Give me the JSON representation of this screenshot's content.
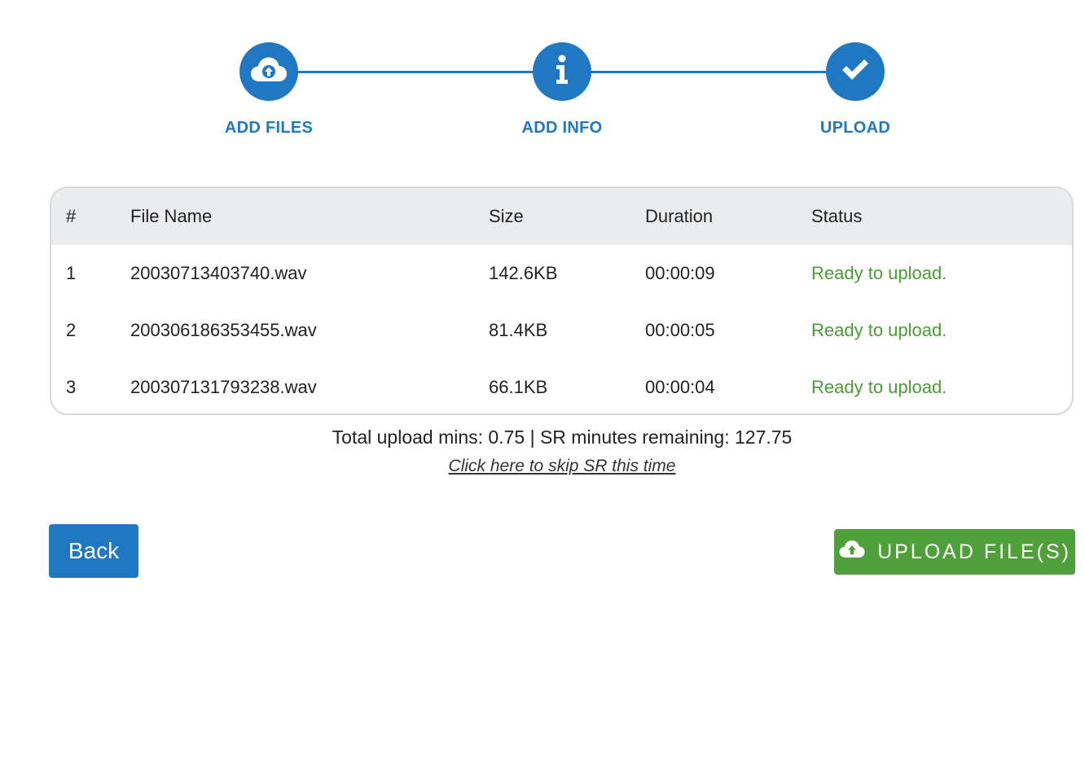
{
  "stepper": {
    "steps": [
      {
        "label": "ADD FILES",
        "icon": "cloud-upload-icon"
      },
      {
        "label": "ADD INFO",
        "icon": "info-icon"
      },
      {
        "label": "UPLOAD",
        "icon": "checkmark-icon"
      }
    ],
    "color": "#1f78c1"
  },
  "table": {
    "headers": {
      "num": "#",
      "name": "File Name",
      "size": "Size",
      "duration": "Duration",
      "status": "Status"
    },
    "rows": [
      {
        "num": "1",
        "name": "20030713403740.wav",
        "size": "142.6KB",
        "duration": "00:00:09",
        "status": "Ready to upload."
      },
      {
        "num": "2",
        "name": "200306186353455.wav",
        "size": "81.4KB",
        "duration": "00:00:05",
        "status": "Ready to upload."
      },
      {
        "num": "3",
        "name": "200307131793238.wav",
        "size": "66.1KB",
        "duration": "00:00:04",
        "status": "Ready to upload."
      }
    ],
    "status_color": "#4a9c35"
  },
  "summary": {
    "text": "Total upload mins: 0.75 | SR minutes remaining: 127.75",
    "skip_link": "Click here to skip SR this time"
  },
  "actions": {
    "back_label": "Back",
    "upload_label": "UPLOAD FILE(S)",
    "upload_icon": "cloud-upload-icon",
    "back_color": "#1f78c1",
    "upload_color": "#4fa03a"
  }
}
